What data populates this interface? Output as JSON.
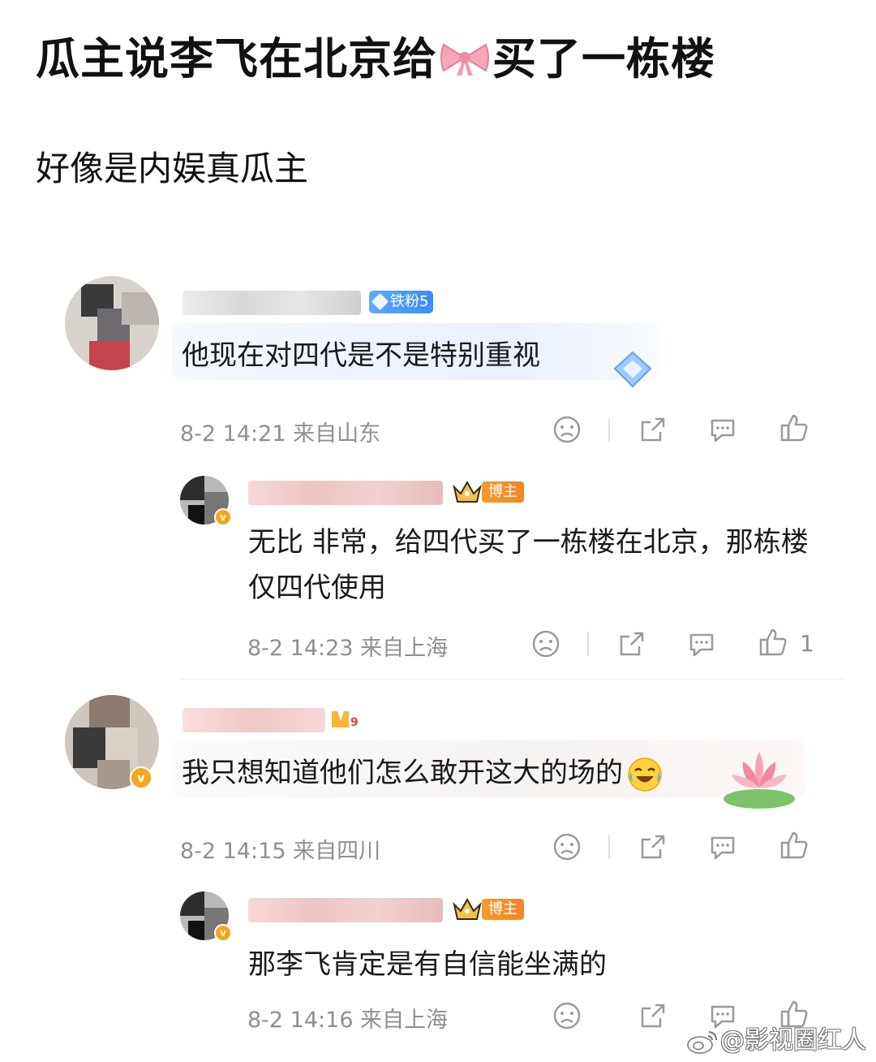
{
  "post": {
    "title_before": "瓜主说李飞在北京给",
    "title_after": "买了一栋楼",
    "subtitle": "好像是内娱真瓜主"
  },
  "comments": [
    {
      "badge": "铁粉5",
      "text": "他现在对四代是不是特别重视",
      "time": "8-2 14:21",
      "location": "来自山东"
    },
    {
      "badge": "博主",
      "text": "无比 非常，给四代买了一栋楼在北京，那栋楼仅四代使用",
      "time": "8-2 14:23",
      "location": "来自上海",
      "likes": "1"
    },
    {
      "text": "我只想知道他们怎么敢开这大的场的",
      "time": "8-2 14:15",
      "location": "来自四川"
    },
    {
      "badge": "博主",
      "text": "那李飞肯定是有自信能坐满的",
      "time": "8-2 14:16",
      "location": "来自上海"
    }
  ],
  "watermark": "@影视圈红人",
  "colors": {
    "meta_gray": "#8f8f8f",
    "fan_badge_blue": "#3d8cf7",
    "host_badge_orange": "#f59a2b",
    "verified_orange": "#f7a51b"
  },
  "icons": [
    "bow-emoji-icon",
    "dislike-icon",
    "share-icon",
    "comment-icon",
    "like-icon",
    "crown-icon",
    "diamond-icon",
    "laugh-cry-emoji-icon",
    "lotus-icon",
    "weibo-logo-icon"
  ]
}
